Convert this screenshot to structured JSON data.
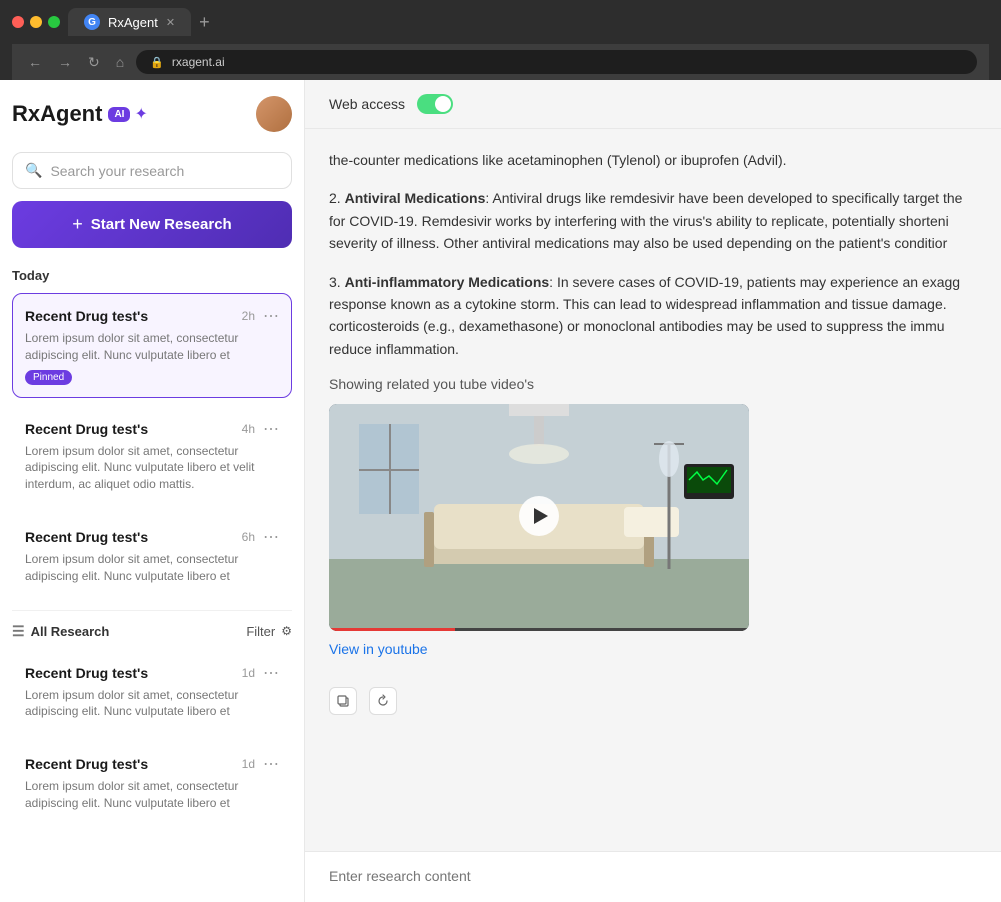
{
  "browser": {
    "tab_title": "RxAgent",
    "tab_favicon": "G",
    "address": "rxagent.ai",
    "add_tab": "+"
  },
  "sidebar": {
    "logo": {
      "rx": "Rx",
      "agent": "Agent",
      "ai_badge": "AI",
      "sparkle": "✦"
    },
    "search_placeholder": "Search your research",
    "new_research_label": "Start New Research",
    "today_label": "Today",
    "all_research_label": "All Research",
    "filter_label": "Filter",
    "today_cards": [
      {
        "title": "Recent Drug test's",
        "time": "2h",
        "excerpt": "Lorem ipsum dolor sit amet, consectetur adipiscing elit. Nunc vulputate libero et",
        "pinned": true,
        "active": true
      },
      {
        "title": "Recent Drug test's",
        "time": "4h",
        "excerpt": "Lorem ipsum dolor sit amet, consectetur adipiscing elit. Nunc vulputate libero et velit interdum, ac aliquet odio mattis.",
        "pinned": false,
        "active": false
      },
      {
        "title": "Recent Drug test's",
        "time": "6h",
        "excerpt": "Lorem ipsum dolor sit amet, consectetur adipiscing elit. Nunc vulputate libero et",
        "pinned": false,
        "active": false
      }
    ],
    "all_research_cards": [
      {
        "title": "Recent Drug test's",
        "time": "1d",
        "excerpt": "Lorem ipsum dolor sit amet, consectetur adipiscing elit. Nunc vulputate libero et",
        "pinned": false,
        "active": false
      },
      {
        "title": "Recent Drug test's",
        "time": "1d",
        "excerpt": "Lorem ipsum dolor sit amet, consectetur adipiscing elit. Nunc vulputate libero et",
        "pinned": false,
        "active": false
      }
    ],
    "pinned_label": "Pinned"
  },
  "main": {
    "web_access_label": "Web access",
    "toggle_on": true,
    "content": {
      "intro_text": "the-counter medications like acetaminophen (Tylenol) or ibuprofen (Advil).",
      "section2_number": "2.",
      "section2_title": "Antiviral Medications",
      "section2_text": ": Antiviral drugs like remdesivir have been developed to specifically target the for COVID-19. Remdesivir works by interfering with the virus's ability to replicate, potentially shorteni severity of illness. Other antiviral medications may also be used depending on the patient's conditior",
      "section3_number": "3.",
      "section3_title": "Anti-inflammatory Medications",
      "section3_text": ": In severe cases of COVID-19, patients may experience an exagg response known as a cytokine storm. This can lead to widespread inflammation and tissue damage. corticosteroids (e.g., dexamethasone) or monoclonal antibodies may be used to suppress the immu reduce inflammation.",
      "youtube_label": "Showing related you tube video's",
      "youtube_link_text": "View in youtube",
      "input_placeholder": "Enter research content"
    }
  }
}
